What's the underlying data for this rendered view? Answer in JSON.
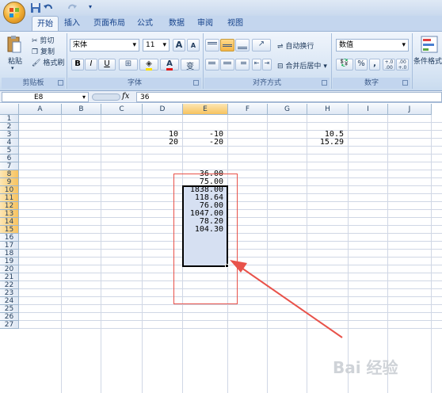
{
  "app": {
    "tabs": [
      "开始",
      "插入",
      "页面布局",
      "公式",
      "数据",
      "审阅",
      "视图"
    ],
    "active_tab": "开始"
  },
  "ribbon": {
    "clipboard": {
      "paste": "粘贴",
      "cut": "剪切",
      "copy": "复制",
      "format_painter": "格式刷",
      "group": "剪贴板"
    },
    "font": {
      "name": "宋体",
      "size": "11",
      "bold": "B",
      "italic": "I",
      "underline": "U",
      "grow": "A",
      "shrink": "A",
      "color_letter": "A",
      "wen": "变",
      "group": "字体"
    },
    "alignment": {
      "wrap": "自动换行",
      "merge": "合并后居中",
      "group": "对齐方式"
    },
    "number": {
      "format": "数值",
      "percent": "%",
      "comma": ",",
      "inc_decimal": "+.0 .00",
      "dec_decimal": ".00 +.0",
      "group": "数字"
    },
    "styles": {
      "conditional": "条件格式"
    }
  },
  "formula_bar": {
    "name_box": "E8",
    "fx": "fx",
    "value": "36"
  },
  "grid": {
    "columns": [
      "A",
      "B",
      "C",
      "D",
      "E",
      "F",
      "G",
      "H",
      "I",
      "J"
    ],
    "rows": [
      "1",
      "2",
      "3",
      "4",
      "5",
      "6",
      "7",
      "8",
      "9",
      "10",
      "11",
      "12",
      "13",
      "14",
      "15",
      "16",
      "17",
      "18",
      "19",
      "20",
      "21",
      "22",
      "23",
      "24",
      "25",
      "26",
      "27"
    ],
    "cells": {
      "D3": "10",
      "E3": "-10",
      "H3": "10.5",
      "D4": "20",
      "E4": "-20",
      "H4": "15.29",
      "E8": "36.00",
      "E9": "75.00",
      "E10": "1838.00",
      "E11": "118.64",
      "E12": "76.00",
      "E13": "1047.00",
      "E14": "78.20",
      "E15": "104.30"
    }
  },
  "colors": {
    "accent": "#f5b445",
    "annotation": "#e8524a",
    "selection": "#d6e0f2"
  },
  "watermark": "Bai 经验"
}
